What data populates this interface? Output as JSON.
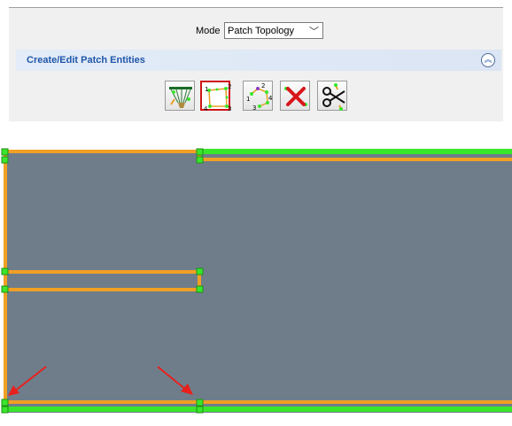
{
  "mode": {
    "label": "Mode",
    "value": "Patch Topology"
  },
  "section": {
    "title": "Create/Edit Patch Entities"
  },
  "toolbar": {
    "tools": [
      {
        "name": "pick-entities",
        "icon": "net-select-icon"
      },
      {
        "name": "create-patch-4-sided",
        "icon": "four-corner-patch-icon",
        "active": true
      },
      {
        "name": "create-patch-multi",
        "icon": "multi-point-patch-icon"
      },
      {
        "name": "delete-patch",
        "icon": "red-x-icon"
      },
      {
        "name": "split-patch",
        "icon": "scissors-icon"
      }
    ],
    "tool2_labels": [
      "1",
      "2",
      "3",
      "4"
    ],
    "tool3_labels": [
      "1",
      "2",
      "3",
      "4"
    ]
  },
  "colors": {
    "surface": "#6f7d8b",
    "edge_orange": "#f0a024",
    "edge_green": "#3ae62c",
    "arrow_red": "#e8201c",
    "active_border": "#d11414"
  }
}
